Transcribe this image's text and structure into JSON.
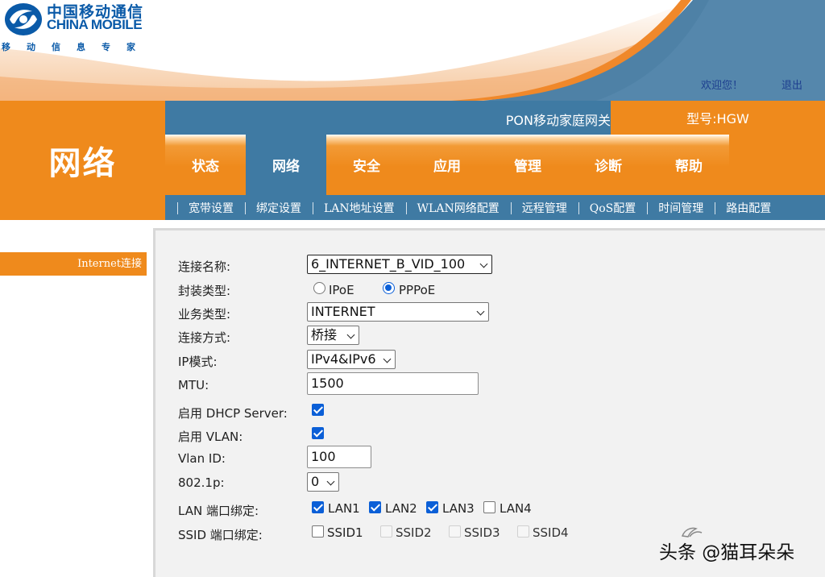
{
  "header": {
    "logo_cn": "中国移动通信",
    "logo_en": "CHINA MOBILE",
    "logo_slogan": "移动信息专家",
    "welcome": "欢迎您！",
    "logout": "退出"
  },
  "navbar": {
    "section_title": "网络",
    "gateway_name": "PON移动家庭网关",
    "model": "型号:HGW",
    "tabs": [
      {
        "label": "状态"
      },
      {
        "label": "网络"
      },
      {
        "label": "安全"
      },
      {
        "label": "应用"
      },
      {
        "label": "管理"
      },
      {
        "label": "诊断"
      },
      {
        "label": "帮助"
      }
    ],
    "active_tab": "网络",
    "subtabs": [
      {
        "label": "宽带设置"
      },
      {
        "label": "绑定设置"
      },
      {
        "label": "LAN地址设置"
      },
      {
        "label": "WLAN网络配置"
      },
      {
        "label": "远程管理"
      },
      {
        "label": "QoS配置"
      },
      {
        "label": "时间管理"
      },
      {
        "label": "路由配置"
      }
    ]
  },
  "sidebar": {
    "items": [
      {
        "label": "Internet连接"
      }
    ]
  },
  "form": {
    "connection_name": {
      "label": "连接名称:",
      "value": "6_INTERNET_B_VID_100"
    },
    "encapsulation": {
      "label": "封装类型:",
      "options": [
        "IPoE",
        "PPPoE"
      ],
      "selected": "PPPoE"
    },
    "service_type": {
      "label": "业务类型:",
      "value": "INTERNET"
    },
    "connection_mode": {
      "label": "连接方式:",
      "value": "桥接"
    },
    "ip_mode": {
      "label": "IP模式:",
      "value": "IPv4&IPv6"
    },
    "mtu": {
      "label": "MTU:",
      "value": "1500"
    },
    "dhcp_server": {
      "label": "启用 DHCP Server:",
      "checked": true
    },
    "vlan": {
      "label": "启用 VLAN:",
      "checked": true
    },
    "vlan_id": {
      "label": "Vlan ID:",
      "value": "100"
    },
    "dot1p": {
      "label": "802.1p:",
      "value": "0"
    },
    "lan_binding": {
      "label": "LAN 端口绑定:",
      "ports": [
        {
          "name": "LAN1",
          "checked": true
        },
        {
          "name": "LAN2",
          "checked": true
        },
        {
          "name": "LAN3",
          "checked": true
        },
        {
          "name": "LAN4",
          "checked": false
        }
      ]
    },
    "ssid_binding": {
      "label": "SSID 端口绑定:",
      "ports": [
        {
          "name": "SSID1",
          "checked": false,
          "disabled": false
        },
        {
          "name": "SSID2",
          "checked": false,
          "disabled": true
        },
        {
          "name": "SSID3",
          "checked": false,
          "disabled": true
        },
        {
          "name": "SSID4",
          "checked": false,
          "disabled": true
        }
      ]
    }
  },
  "watermark": {
    "text": "头条 @猫耳朵朵"
  },
  "colors": {
    "brand_orange": "#ef8a1c",
    "nav_blue": "#3f7aa3",
    "link_blue": "#1d3f8f",
    "checkbox_blue": "#0b5fd7"
  },
  "icons": {
    "logo": "china-mobile-logo-icon",
    "dropdown": "chevron-down-icon",
    "checkbox": "checkbox-icon",
    "radio": "radio-icon",
    "watermark": "toutiao-icon"
  }
}
